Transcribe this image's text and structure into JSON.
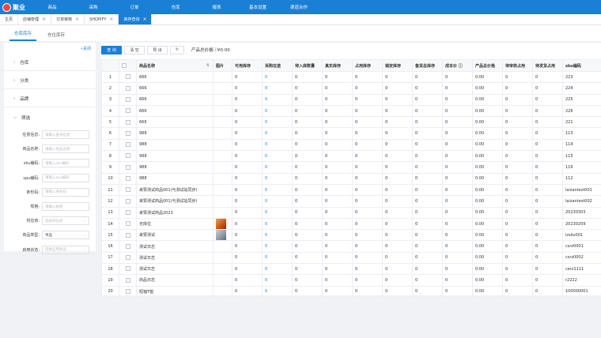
{
  "logo": {
    "text": "聚业"
  },
  "nav": [
    "商品",
    "采购",
    "订单",
    "仓库",
    "报表",
    "基本设置",
    "渠道合作"
  ],
  "tabs": [
    {
      "label": "主页",
      "closable": false,
      "active": false
    },
    {
      "label": "店铺管理",
      "closable": true,
      "active": false
    },
    {
      "label": "订单审核",
      "closable": true,
      "active": false
    },
    {
      "label": "SHOPIFY",
      "closable": true,
      "active": false
    },
    {
      "label": "库存查询",
      "closable": true,
      "active": true
    }
  ],
  "subtabs": [
    {
      "label": "仓库库存",
      "active": true
    },
    {
      "label": "仓位库存",
      "active": false
    }
  ],
  "sidebar": {
    "collapse": "«关闭",
    "sections": [
      "仓库",
      "分类",
      "品牌"
    ],
    "filter_title": "筛选",
    "fields": [
      {
        "label": "任意信息:",
        "placeholder": "请输入查询信息",
        "value": "",
        "dropdown": false
      },
      {
        "label": "商品名称:",
        "placeholder": "请输入商品名称",
        "value": "",
        "dropdown": false
      },
      {
        "label": "sku编码:",
        "placeholder": "请输入sku编码",
        "value": "",
        "dropdown": false
      },
      {
        "label": "spu编码:",
        "placeholder": "请输入spu编码",
        "value": "",
        "dropdown": false
      },
      {
        "label": "条形码:",
        "placeholder": "请输入条形码",
        "value": "",
        "dropdown": false
      },
      {
        "label": "规格:",
        "placeholder": "请输入规格",
        "value": "",
        "dropdown": false
      },
      {
        "label": "供应商:",
        "placeholder": "选择供应商",
        "value": "",
        "dropdown": true
      },
      {
        "label": "商品类型:",
        "placeholder": "",
        "value": "单品",
        "dropdown": true
      },
      {
        "label": "启用状态:",
        "placeholder": "选择启用状态",
        "value": "",
        "dropdown": true
      }
    ]
  },
  "toolbar": {
    "query": "查 询",
    "clear": "清 空",
    "export": "导 出",
    "refresh": "↻",
    "total_label": "产品总价格",
    "total_value": "¥0.00"
  },
  "table": {
    "headers": [
      "",
      "",
      "商品名称",
      "图片",
      "可用库存",
      "采购在途",
      "待入库数量",
      "真实库存",
      "占用库存",
      "锁定库存",
      "备货总库存",
      "成本价",
      "产品总价格",
      "待审核占用",
      "待发货占用",
      "sku编码"
    ],
    "rows": [
      {
        "no": "1",
        "name": "666",
        "img": "",
        "sku": "223"
      },
      {
        "no": "2",
        "name": "666",
        "img": "",
        "sku": "224"
      },
      {
        "no": "3",
        "name": "666",
        "img": "",
        "sku": "225"
      },
      {
        "no": "4",
        "name": "666",
        "img": "",
        "sku": "226"
      },
      {
        "no": "5",
        "name": "666",
        "img": "",
        "sku": "221"
      },
      {
        "no": "6",
        "name": "988",
        "img": "",
        "sku": "113"
      },
      {
        "no": "7",
        "name": "988",
        "img": "",
        "sku": "114"
      },
      {
        "no": "8",
        "name": "988",
        "img": "",
        "sku": "115"
      },
      {
        "no": "9",
        "name": "988",
        "img": "",
        "sku": "116"
      },
      {
        "no": "10",
        "name": "988",
        "img": "",
        "sku": "112"
      },
      {
        "no": "11",
        "name": "来赞测试商品001(与测试站同步)",
        "img": "",
        "sku": "laizantest001"
      },
      {
        "no": "12",
        "name": "来赞测试商品001(与测试站同步)",
        "img": "",
        "sku": "laizantest002"
      },
      {
        "no": "13",
        "name": "来赞测试商品2023",
        "img": "",
        "sku": "20230303"
      },
      {
        "no": "14",
        "name": "无库位",
        "img": "t1",
        "sku": "20230209"
      },
      {
        "no": "15",
        "name": "来赞测试",
        "img": "t2",
        "sku": "lzsku001"
      },
      {
        "no": "16",
        "name": "测试日志",
        "img": "",
        "sku": "csrz0001"
      },
      {
        "no": "17",
        "name": "测试日志",
        "img": "",
        "sku": "csrz0002"
      },
      {
        "no": "18",
        "name": "测试日志",
        "img": "",
        "sku": "cerz1111"
      },
      {
        "no": "19",
        "name": "商品日志",
        "img": "",
        "sku": "r2222"
      },
      {
        "no": "20",
        "name": "短袖T恤",
        "img": "",
        "sku": "100000001"
      }
    ],
    "zero": "0",
    "zero_price": "0.00"
  }
}
